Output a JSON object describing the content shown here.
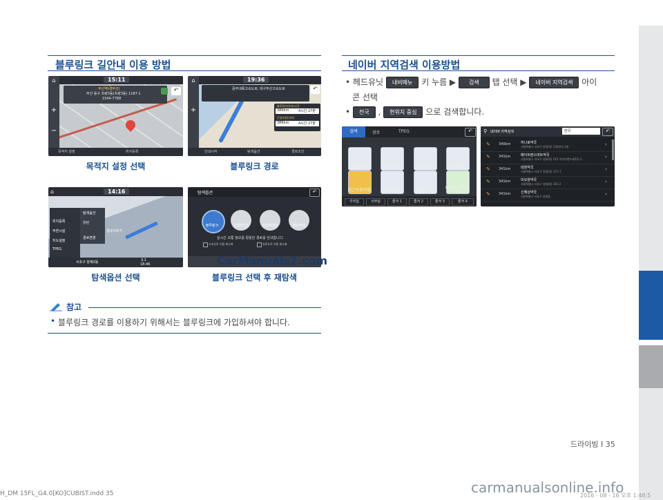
{
  "left": {
    "title": "블루링크 길안내 이용 방법",
    "captions": [
      "목적지 설정 선택",
      "블루링크 경로",
      "탐색옵션 선택",
      "블루링크 선택 후 재탐색"
    ],
    "shot1": {
      "time": "15:11",
      "poi_name": "부산역(경부선)",
      "poi_addr": "부산 동구 초량3동(초량3동) 1187-1",
      "poi_phone": "1544-7788",
      "btn_a": "목적지 설정",
      "btn_b": "위치등록"
    },
    "shot2": {
      "time": "19:36",
      "route_a": "중부내륙고속도로, 대구부산고속도로",
      "label_a": "블루링크(유실시간)",
      "dist_a": "386km",
      "time_a": "4시간 27분",
      "label_b": "단일추천(거리)",
      "dist_b": "386km",
      "time_b": "4시간 27분",
      "btn_a": "안내시작",
      "btn_b": "탐색옵션",
      "btn_c": "경로조건"
    },
    "shot3": {
      "time": "14:16",
      "menu": [
        "탐색옵션",
        "유턴",
        "경유지추가",
        "경로변경",
        "TPEG",
        "위치등록",
        "주변시설",
        "지도설정"
      ],
      "address": "서초구 양재2동",
      "bottom_dist": "3.1",
      "bottom_time": "18:46"
    },
    "shot4": {
      "header": "탐색옵션",
      "options": [
        "블루링크",
        "단일추천1",
        "단일추천2",
        "최단거리"
      ],
      "info": "실시간 교통 정보를 활용한 경로를 안내합니다.",
      "check_a": "고속도로 이용 최소화",
      "check_b": "유료도로 이용 최소화"
    },
    "watermark": "CarManuals2.com",
    "note_title": "참고",
    "note_text": "블루링크 경로를 이용하기 위해서는 블루링크에 가입하셔야 합니다."
  },
  "right": {
    "title": "네이버 지역검색 이용방법",
    "line1_a": "헤드유닛",
    "btn_menu": "내비메뉴",
    "line1_b": "키 누름 ▶",
    "btn_search": "검색",
    "line1_c": "탭 선택 ▶",
    "btn_naver": "네이버 지역검색",
    "line1_d": "아이",
    "line2": "콘 선택",
    "btn_all": "전국",
    "comma": ",",
    "btn_current": "현위치 중심",
    "line3": "으로 검색합니다.",
    "shotA": {
      "tabs": [
        "검색",
        "경로",
        "TPEG"
      ],
      "icons": [
        "통합검색",
        "주소검색",
        "시설검색",
        "테마검색",
        "최근사용지점",
        "등록지점",
        "이전지도",
        "네이버 지역검색"
      ],
      "bottom": [
        "우리집",
        "사무실",
        "즐겨 1",
        "즐겨 2",
        "즐겨 3",
        "즐겨 4"
      ]
    },
    "shotB": {
      "header": "네이버 지역검색",
      "region": "한국",
      "results": [
        {
          "dist": "340km",
          "name": "하나로약국",
          "addr": "서울특별시 서초구 양재2동 230번지 1층"
        },
        {
          "dist": "341km",
          "name": "메이트팜스마트약국",
          "addr": "서울특별시 서초구 양재2동 215 하이브랜드제2관 2..."
        },
        {
          "dist": "341km",
          "name": "대양약국",
          "addr": "서울특별시 서초구 양재2동 327-7"
        },
        {
          "dist": "341km",
          "name": "미모양약국",
          "addr": "서울특별시 서초구 양재2동 361-2"
        },
        {
          "dist": "341km",
          "name": "신해성약국",
          "addr": "서울특별시 서초구 양재동"
        }
      ]
    }
  },
  "footer": {
    "page_label": "드라이빙 I 35",
    "file_info": "H_DM 15FL_G4.0[KO]CUBIST.indd   35",
    "date_info": "2016 - 08 - 16   오후 1:48:5",
    "site": "carmanualsonline.info"
  },
  "colors": {
    "accent": "#1a4f8c",
    "tab_blue": "#1d5aa6",
    "tab_gray": "#a9abae",
    "tab_light": "#e6e7e9"
  }
}
